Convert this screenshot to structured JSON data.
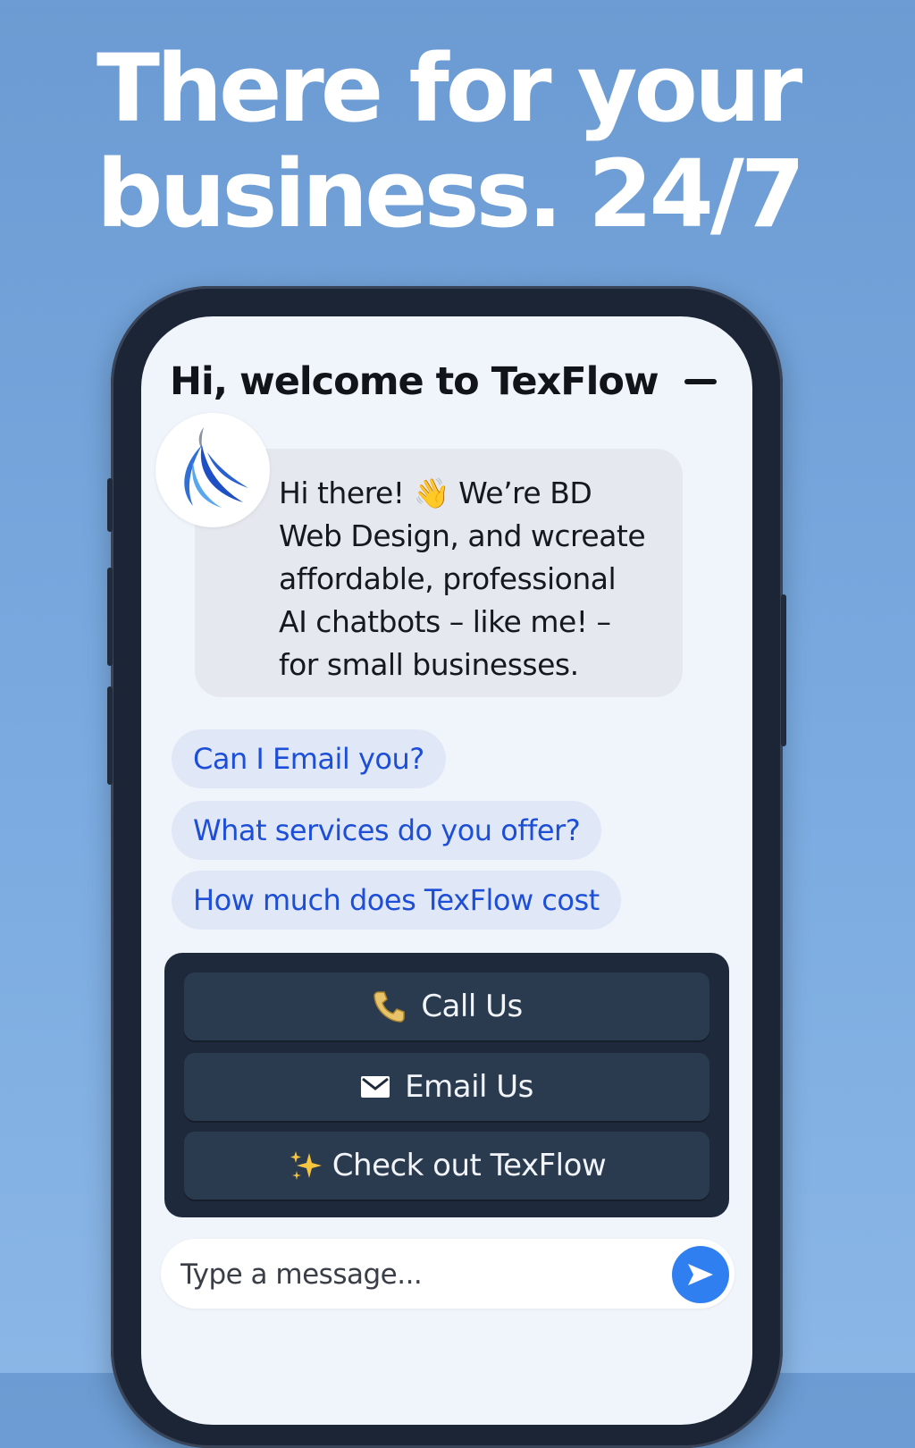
{
  "headline": {
    "line1": "There for your",
    "line2": "business. 24/7"
  },
  "chat": {
    "title": "Hi, welcome to TexFlow",
    "minimize_icon": "minimize-icon",
    "avatar_icon": "texflow-logo-icon",
    "message": {
      "line1": "Hi there! 👋 We’re BD",
      "line2": "Web Design, and wcreate",
      "line3": "affordable, professional",
      "line4": "AI chatbots – like me! –",
      "line5": "for small businesses."
    },
    "suggestions": [
      "Can I Email you?",
      "What services do you offer?",
      "How much does TexFlow cost"
    ],
    "actions": [
      {
        "icon": "phone-icon",
        "label": "Call Us"
      },
      {
        "icon": "envelope-icon",
        "label": "Email Us"
      },
      {
        "icon": "sparkles-icon",
        "label": "Check out TexFlow"
      }
    ],
    "input": {
      "placeholder": "Type a message...",
      "value": ""
    },
    "send_icon": "send-arrow-icon"
  },
  "colors": {
    "background": "#6b9bd2",
    "screen": "#f0f4fb",
    "bubble": "#e5e9ef",
    "suggestion_bg": "#e0e8f7",
    "suggestion_text": "#1d4ed8",
    "action_panel": "#1e293b",
    "action_button": "#2a3a4f",
    "send_button": "#2f7ff0"
  }
}
